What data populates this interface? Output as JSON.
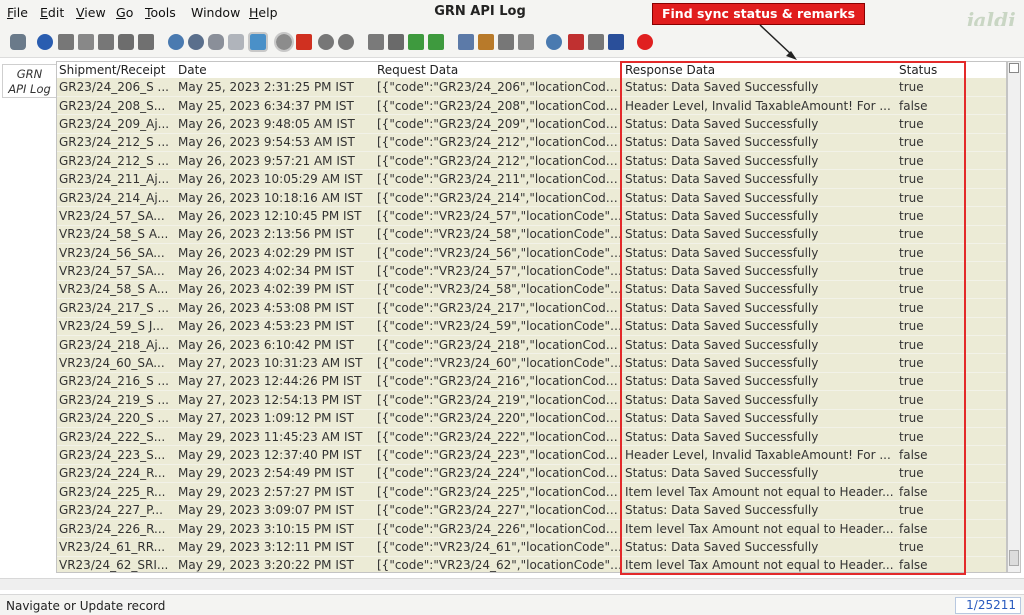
{
  "window": {
    "title": "GRN API Log",
    "logo": "jaldi"
  },
  "menu": [
    {
      "label": "File",
      "mn": "F",
      "rest": "ile"
    },
    {
      "label": "Edit",
      "mn": "E",
      "rest": "dit"
    },
    {
      "label": "View",
      "mn": "V",
      "rest": "iew"
    },
    {
      "label": "Go",
      "mn": "G",
      "rest": "o"
    },
    {
      "label": "Tools",
      "mn": "T",
      "rest": "ools"
    },
    {
      "label": "Window",
      "mn": "",
      "rest": "Window"
    },
    {
      "label": "Help",
      "mn": "H",
      "rest": "elp"
    }
  ],
  "toolbar_icons": [
    "undo-icon",
    "help-icon",
    "new-icon",
    "copy-icon",
    "delete-icon",
    "settings-icon",
    "save-icon",
    "refresh-icon",
    "find-icon",
    "attach-icon",
    "chat-icon",
    "fullscreen-icon",
    "history-icon",
    "home-icon",
    "back-icon",
    "forward-icon",
    "first-icon",
    "up-icon",
    "down-icon",
    "last-icon",
    "report-icon",
    "archive-icon",
    "print-icon",
    "print-preview-icon",
    "zoom-icon",
    "workflow-icon",
    "product-icon",
    "window-icon",
    "close-icon"
  ],
  "annotation": {
    "callout": "Find sync status & remarks"
  },
  "side_tab": {
    "line1": "GRN",
    "line2": "API Log"
  },
  "grid": {
    "columns": [
      "Shipment/Receipt",
      "Date",
      "Request Data",
      "Response Data",
      "Status"
    ],
    "rows": [
      [
        "GR23/24_206_S ...",
        "May 25, 2023 2:31:25 PM IST",
        "[{\"code\":\"GR23/24_206\",\"locationCode...",
        "Status: Data Saved Successfully",
        "true"
      ],
      [
        "GR23/24_208_S...",
        "May 25, 2023 6:34:37 PM IST",
        "[{\"code\":\"GR23/24_208\",\"locationCode...",
        "Header Level, Invalid TaxableAmount! For ...",
        "false"
      ],
      [
        "GR23/24_209_Aj...",
        "May 26, 2023 9:48:05 AM IST",
        "[{\"code\":\"GR23/24_209\",\"locationCode...",
        "Status: Data Saved Successfully",
        "true"
      ],
      [
        "GR23/24_212_S ...",
        "May 26, 2023 9:54:53 AM IST",
        "[{\"code\":\"GR23/24_212\",\"locationCode...",
        "Status: Data Saved Successfully",
        "true"
      ],
      [
        "GR23/24_212_S ...",
        "May 26, 2023 9:57:21 AM IST",
        "[{\"code\":\"GR23/24_212\",\"locationCode...",
        "Status: Data Saved Successfully",
        "true"
      ],
      [
        "GR23/24_211_Aj...",
        "May 26, 2023 10:05:29 AM IST",
        "[{\"code\":\"GR23/24_211\",\"locationCode...",
        "Status: Data Saved Successfully",
        "true"
      ],
      [
        "GR23/24_214_Aj...",
        "May 26, 2023 10:18:16 AM IST",
        "[{\"code\":\"GR23/24_214\",\"locationCode...",
        "Status: Data Saved Successfully",
        "true"
      ],
      [
        "VR23/24_57_SA...",
        "May 26, 2023 12:10:45 PM IST",
        "[{\"code\":\"VR23/24_57\",\"locationCode\":\"...",
        "Status: Data Saved Successfully",
        "true"
      ],
      [
        "VR23/24_58_S A...",
        "May 26, 2023 2:13:56 PM IST",
        "[{\"code\":\"VR23/24_58\",\"locationCode\":\"...",
        "Status: Data Saved Successfully",
        "true"
      ],
      [
        "VR23/24_56_SA...",
        "May 26, 2023 4:02:29 PM IST",
        "[{\"code\":\"VR23/24_56\",\"locationCode\":\"...",
        "Status: Data Saved Successfully",
        "true"
      ],
      [
        "VR23/24_57_SA...",
        "May 26, 2023 4:02:34 PM IST",
        "[{\"code\":\"VR23/24_57\",\"locationCode\":\"...",
        "Status: Data Saved Successfully",
        "true"
      ],
      [
        "VR23/24_58_S A...",
        "May 26, 2023 4:02:39 PM IST",
        "[{\"code\":\"VR23/24_58\",\"locationCode\":\"...",
        "Status: Data Saved Successfully",
        "true"
      ],
      [
        "GR23/24_217_S ...",
        "May 26, 2023 4:53:08 PM IST",
        "[{\"code\":\"GR23/24_217\",\"locationCode...",
        "Status: Data Saved Successfully",
        "true"
      ],
      [
        "VR23/24_59_S J...",
        "May 26, 2023 4:53:23 PM IST",
        "[{\"code\":\"VR23/24_59\",\"locationCode\":\"...",
        "Status: Data Saved Successfully",
        "true"
      ],
      [
        "GR23/24_218_Aj...",
        "May 26, 2023 6:10:42 PM IST",
        "[{\"code\":\"GR23/24_218\",\"locationCode...",
        "Status: Data Saved Successfully",
        "true"
      ],
      [
        "VR23/24_60_SA...",
        "May 27, 2023 10:31:23 AM IST",
        "[{\"code\":\"VR23/24_60\",\"locationCode\":\"...",
        "Status: Data Saved Successfully",
        "true"
      ],
      [
        "GR23/24_216_S ...",
        "May 27, 2023 12:44:26 PM IST",
        "[{\"code\":\"GR23/24_216\",\"locationCode...",
        "Status: Data Saved Successfully",
        "true"
      ],
      [
        "GR23/24_219_S ...",
        "May 27, 2023 12:54:13 PM IST",
        "[{\"code\":\"GR23/24_219\",\"locationCode...",
        "Status: Data Saved Successfully",
        "true"
      ],
      [
        "GR23/24_220_S ...",
        "May 27, 2023 1:09:12 PM IST",
        "[{\"code\":\"GR23/24_220\",\"locationCode...",
        "Status: Data Saved Successfully",
        "true"
      ],
      [
        "GR23/24_222_S...",
        "May 29, 2023 11:45:23 AM IST",
        "[{\"code\":\"GR23/24_222\",\"locationCode...",
        "Status: Data Saved Successfully",
        "true"
      ],
      [
        "GR23/24_223_S...",
        "May 29, 2023 12:37:40 PM IST",
        "[{\"code\":\"GR23/24_223\",\"locationCode...",
        "Header Level, Invalid TaxableAmount! For ...",
        "false"
      ],
      [
        "GR23/24_224_R...",
        "May 29, 2023 2:54:49 PM IST",
        "[{\"code\":\"GR23/24_224\",\"locationCode...",
        "Status: Data Saved Successfully",
        "true"
      ],
      [
        "GR23/24_225_R...",
        "May 29, 2023 2:57:27 PM IST",
        "[{\"code\":\"GR23/24_225\",\"locationCode...",
        "Item level Tax Amount not equal to Header...",
        "false"
      ],
      [
        "GR23/24_227_P...",
        "May 29, 2023 3:09:07 PM IST",
        "[{\"code\":\"GR23/24_227\",\"locationCode...",
        "Status: Data Saved Successfully",
        "true"
      ],
      [
        "GR23/24_226_R...",
        "May 29, 2023 3:10:15 PM IST",
        "[{\"code\":\"GR23/24_226\",\"locationCode...",
        "Item level Tax Amount not equal to Header...",
        "false"
      ],
      [
        "VR23/24_61_RR...",
        "May 29, 2023 3:12:11 PM IST",
        "[{\"code\":\"VR23/24_61\",\"locationCode\":\"...",
        "Status: Data Saved Successfully",
        "true"
      ],
      [
        "VR23/24_62_SRI...",
        "May 29, 2023 3:20:22 PM IST",
        "[{\"code\":\"VR23/24_62\",\"locationCode\":\"...",
        "Item level Tax Amount not equal to Header...",
        "false"
      ]
    ]
  },
  "status_bar": {
    "message": "Navigate or Update record",
    "record_count": "1/25211"
  },
  "colors": {
    "row_bg": "#ecebd6",
    "callout_bg": "#e11d1d",
    "highlight_border": "#e32a2a",
    "record_count_text": "#2a5bbf"
  }
}
